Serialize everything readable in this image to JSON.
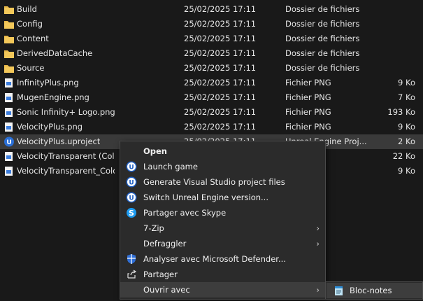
{
  "files": [
    {
      "name": "Build",
      "date": "25/02/2025 17:11",
      "type": "Dossier de fichiers",
      "size": "",
      "icon": "folder-icon"
    },
    {
      "name": "Config",
      "date": "25/02/2025 17:11",
      "type": "Dossier de fichiers",
      "size": "",
      "icon": "folder-icon"
    },
    {
      "name": "Content",
      "date": "25/02/2025 17:11",
      "type": "Dossier de fichiers",
      "size": "",
      "icon": "folder-icon"
    },
    {
      "name": "DerivedDataCache",
      "date": "25/02/2025 17:11",
      "type": "Dossier de fichiers",
      "size": "",
      "icon": "folder-icon"
    },
    {
      "name": "Source",
      "date": "25/02/2025 17:11",
      "type": "Dossier de fichiers",
      "size": "",
      "icon": "folder-icon"
    },
    {
      "name": "InfinityPlus.png",
      "date": "25/02/2025 17:11",
      "type": "Fichier PNG",
      "size": "9 Ko",
      "icon": "image-file-icon"
    },
    {
      "name": "MugenEngine.png",
      "date": "25/02/2025 17:11",
      "type": "Fichier PNG",
      "size": "7 Ko",
      "icon": "image-file-icon"
    },
    {
      "name": "Sonic Infinity+ Logo.png",
      "date": "25/02/2025 17:11",
      "type": "Fichier PNG",
      "size": "193 Ko",
      "icon": "image-file-icon"
    },
    {
      "name": "VelocityPlus.png",
      "date": "25/02/2025 17:11",
      "type": "Fichier PNG",
      "size": "9 Ko",
      "icon": "image-file-icon"
    },
    {
      "name": "VelocityPlus.uproject",
      "date": "25/02/2025 17:11",
      "type": "Unreal Engine Proj...",
      "size": "2 Ko",
      "icon": "unreal-project-icon"
    },
    {
      "name": "VelocityTransparent (ColorVa",
      "date": "",
      "type": "",
      "size": "22 Ko",
      "icon": "image-file-icon"
    },
    {
      "name": "VelocityTransparent_ColorVa",
      "date": "",
      "type": "",
      "size": "9 Ko",
      "icon": "image-file-icon"
    }
  ],
  "context_menu": {
    "items": [
      {
        "label": "Open",
        "icon": "",
        "bold": true,
        "arrow": ""
      },
      {
        "label": "Launch game",
        "icon": "unreal-icon",
        "arrow": ""
      },
      {
        "label": "Generate Visual Studio project files",
        "icon": "unreal-icon",
        "arrow": ""
      },
      {
        "label": "Switch Unreal Engine version...",
        "icon": "unreal-icon",
        "arrow": ""
      },
      {
        "label": "Partager avec Skype",
        "icon": "skype-icon",
        "arrow": ""
      },
      {
        "label": "7-Zip",
        "icon": "",
        "arrow": "›"
      },
      {
        "label": "Defraggler",
        "icon": "",
        "arrow": "›"
      },
      {
        "label": "Analyser avec Microsoft Defender...",
        "icon": "defender-shield-icon",
        "arrow": ""
      },
      {
        "label": "Partager",
        "icon": "share-icon",
        "arrow": ""
      },
      {
        "label": "Ouvrir avec",
        "icon": "",
        "arrow": "›",
        "hover": true
      }
    ]
  },
  "submenu": {
    "label": "Bloc-notes",
    "icon": "notepad-icon"
  },
  "colors": {
    "folder": "#e8b84a",
    "accent": "#3b7ddd",
    "selected_row": "#3a3a3a",
    "menu_bg": "#2b2b2b"
  }
}
